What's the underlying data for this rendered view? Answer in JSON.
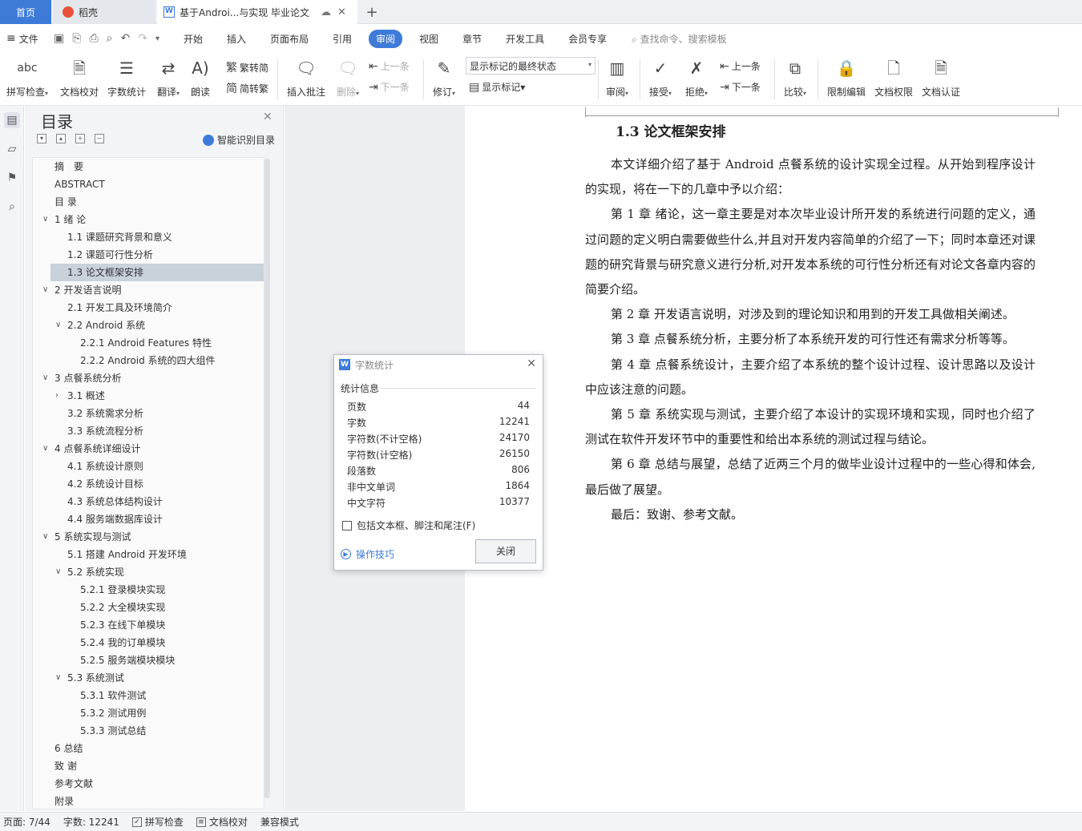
{
  "tabs": {
    "home": "首页",
    "daoke": "稻壳",
    "doc": "基于Androi...与实现 毕业论文",
    "add": "+"
  },
  "menu": {
    "file": "文件",
    "tabs": [
      "开始",
      "插入",
      "页面布局",
      "引用",
      "审阅",
      "视图",
      "章节",
      "开发工具",
      "会员专享"
    ],
    "active": "审阅",
    "search": "查找命令、搜索模板"
  },
  "ribbon": {
    "spellcheck": "拼写检查",
    "proofread": "文档校对",
    "wordcount": "字数统计",
    "translate": "翻译",
    "read": "朗读",
    "trad_to_simp": "繁转简",
    "simp_to_trad": "简转繁",
    "insert_comment": "插入批注",
    "delete": "删除",
    "prev_comment": "上一条",
    "next_comment": "下一条",
    "revise": "修订",
    "markup_state": "显示标记的最终状态",
    "show_markup": "显示标记",
    "review": "审阅",
    "accept": "接受",
    "reject": "拒绝",
    "prev_change": "上一条",
    "next_change": "下一条",
    "compare": "比较",
    "restrict_edit": "限制编辑",
    "doc_permission": "文档权限",
    "doc_cert": "文档认证"
  },
  "toc": {
    "title": "目录",
    "smart": "智能识别目录",
    "items": [
      {
        "label": "摘　要",
        "level": 1,
        "chev": ""
      },
      {
        "label": "ABSTRACT",
        "level": 1,
        "chev": ""
      },
      {
        "label": "目  录",
        "level": 1,
        "chev": ""
      },
      {
        "label": "1 绪  论",
        "level": 1,
        "chev": "v"
      },
      {
        "label": "1.1 课题研究背景和意义",
        "level": 2,
        "chev": ""
      },
      {
        "label": "1.2 课题可行性分析",
        "level": 2,
        "chev": ""
      },
      {
        "label": "1.3 论文框架安排",
        "level": 2,
        "chev": "",
        "selected": true
      },
      {
        "label": "2  开发语言说明",
        "level": 1,
        "chev": "v"
      },
      {
        "label": "2.1  开发工具及环境简介",
        "level": 2,
        "chev": ""
      },
      {
        "label": "2.2 Android 系统",
        "level": 2,
        "chev": "v"
      },
      {
        "label": "2.2.1 Android Features 特性",
        "level": 3,
        "chev": ""
      },
      {
        "label": "2.2.2 Android 系统的四大组件",
        "level": 3,
        "chev": ""
      },
      {
        "label": "3  点餐系统分析",
        "level": 1,
        "chev": "v"
      },
      {
        "label": "3.1 概述",
        "level": 2,
        "chev": ">"
      },
      {
        "label": "3.2 系统需求分析",
        "level": 2,
        "chev": ""
      },
      {
        "label": "3.3 系统流程分析",
        "level": 2,
        "chev": ""
      },
      {
        "label": "4  点餐系统详细设计",
        "level": 1,
        "chev": "v"
      },
      {
        "label": "4.1  系统设计原则",
        "level": 2,
        "chev": ""
      },
      {
        "label": "4.2  系统设计目标",
        "level": 2,
        "chev": ""
      },
      {
        "label": "4.3 系统总体结构设计",
        "level": 2,
        "chev": ""
      },
      {
        "label": "4.4 服务端数据库设计",
        "level": 2,
        "chev": ""
      },
      {
        "label": "5 系统实现与测试",
        "level": 1,
        "chev": "v"
      },
      {
        "label": "5.1  搭建 Android 开发环境",
        "level": 2,
        "chev": ""
      },
      {
        "label": "5.2 系统实现",
        "level": 2,
        "chev": "v"
      },
      {
        "label": "5.2.1  登录模块实现",
        "level": 3,
        "chev": ""
      },
      {
        "label": "5.2.2  大全模块实现",
        "level": 3,
        "chev": ""
      },
      {
        "label": "5.2.3  在线下单模块",
        "level": 3,
        "chev": ""
      },
      {
        "label": "5.2.4  我的订单模块",
        "level": 3,
        "chev": ""
      },
      {
        "label": "5.2.5  服务端模块模块",
        "level": 3,
        "chev": ""
      },
      {
        "label": "5.3  系统测试",
        "level": 2,
        "chev": "v"
      },
      {
        "label": "5.3.1  软件测试",
        "level": 3,
        "chev": ""
      },
      {
        "label": "5.3.2  测试用例",
        "level": 3,
        "chev": ""
      },
      {
        "label": "5.3.3  测试总结",
        "level": 3,
        "chev": ""
      },
      {
        "label": "6  总结",
        "level": 1,
        "chev": ""
      },
      {
        "label": "致  谢",
        "level": 1,
        "chev": ""
      },
      {
        "label": "参考文献",
        "level": 1,
        "chev": ""
      },
      {
        "label": "附录",
        "level": 1,
        "chev": ""
      }
    ]
  },
  "document": {
    "section_title": "1.3 论文框架安排",
    "paragraphs": [
      "本文详细介绍了基于 Android 点餐系统的设计实现全过程。从开始到程序设计的实现，将在一下的几章中予以介绍：",
      "第 1 章  绪论，这一章主要是对本次毕业设计所开发的系统进行问题的定义，通过问题的定义明白需要做些什么,并且对开发内容简单的介绍了一下；同时本章还对课题的研究背景与研究意义进行分析,对开发本系统的可行性分析还有对论文各章内容的简要介绍。",
      "第 2 章  开发语言说明，对涉及到的理论知识和用到的开发工具做相关阐述。",
      "第 3 章  点餐系统分析，主要分析了本系统开发的可行性还有需求分析等等。",
      "第 4 章  点餐系统设计，主要介绍了本系统的整个设计过程、设计思路以及设计中应该注意的问题。",
      "第 5 章  系统实现与测试，主要介绍了本设计的实现环境和实现，同时也介绍了测试在软件开发环节中的重要性和给出本系统的测试过程与结论。",
      "第 6 章  总结与展望，总结了近两三个月的做毕业设计过程中的一些心得和体会,最后做了展望。",
      "最后：致谢、参考文献。"
    ]
  },
  "dialog": {
    "title": "字数统计",
    "section": "统计信息",
    "stats": [
      {
        "label": "页数",
        "value": "44"
      },
      {
        "label": "字数",
        "value": "12241"
      },
      {
        "label": "字符数(不计空格)",
        "value": "24170"
      },
      {
        "label": "字符数(计空格)",
        "value": "26150"
      },
      {
        "label": "段落数",
        "value": "806"
      },
      {
        "label": "非中文单词",
        "value": "1864"
      },
      {
        "label": "中文字符",
        "value": "10377"
      }
    ],
    "checkbox": "包括文本框、脚注和尾注(F)",
    "tips": "操作技巧",
    "close": "关闭"
  },
  "status": {
    "page": "页面: 7/44",
    "words": "字数: 12241",
    "spell": "拼写检查",
    "proof": "文档校对",
    "compat": "兼容模式"
  },
  "colors": {
    "accent": "#3e7bd9",
    "toc_selected": "#c9d1db"
  }
}
